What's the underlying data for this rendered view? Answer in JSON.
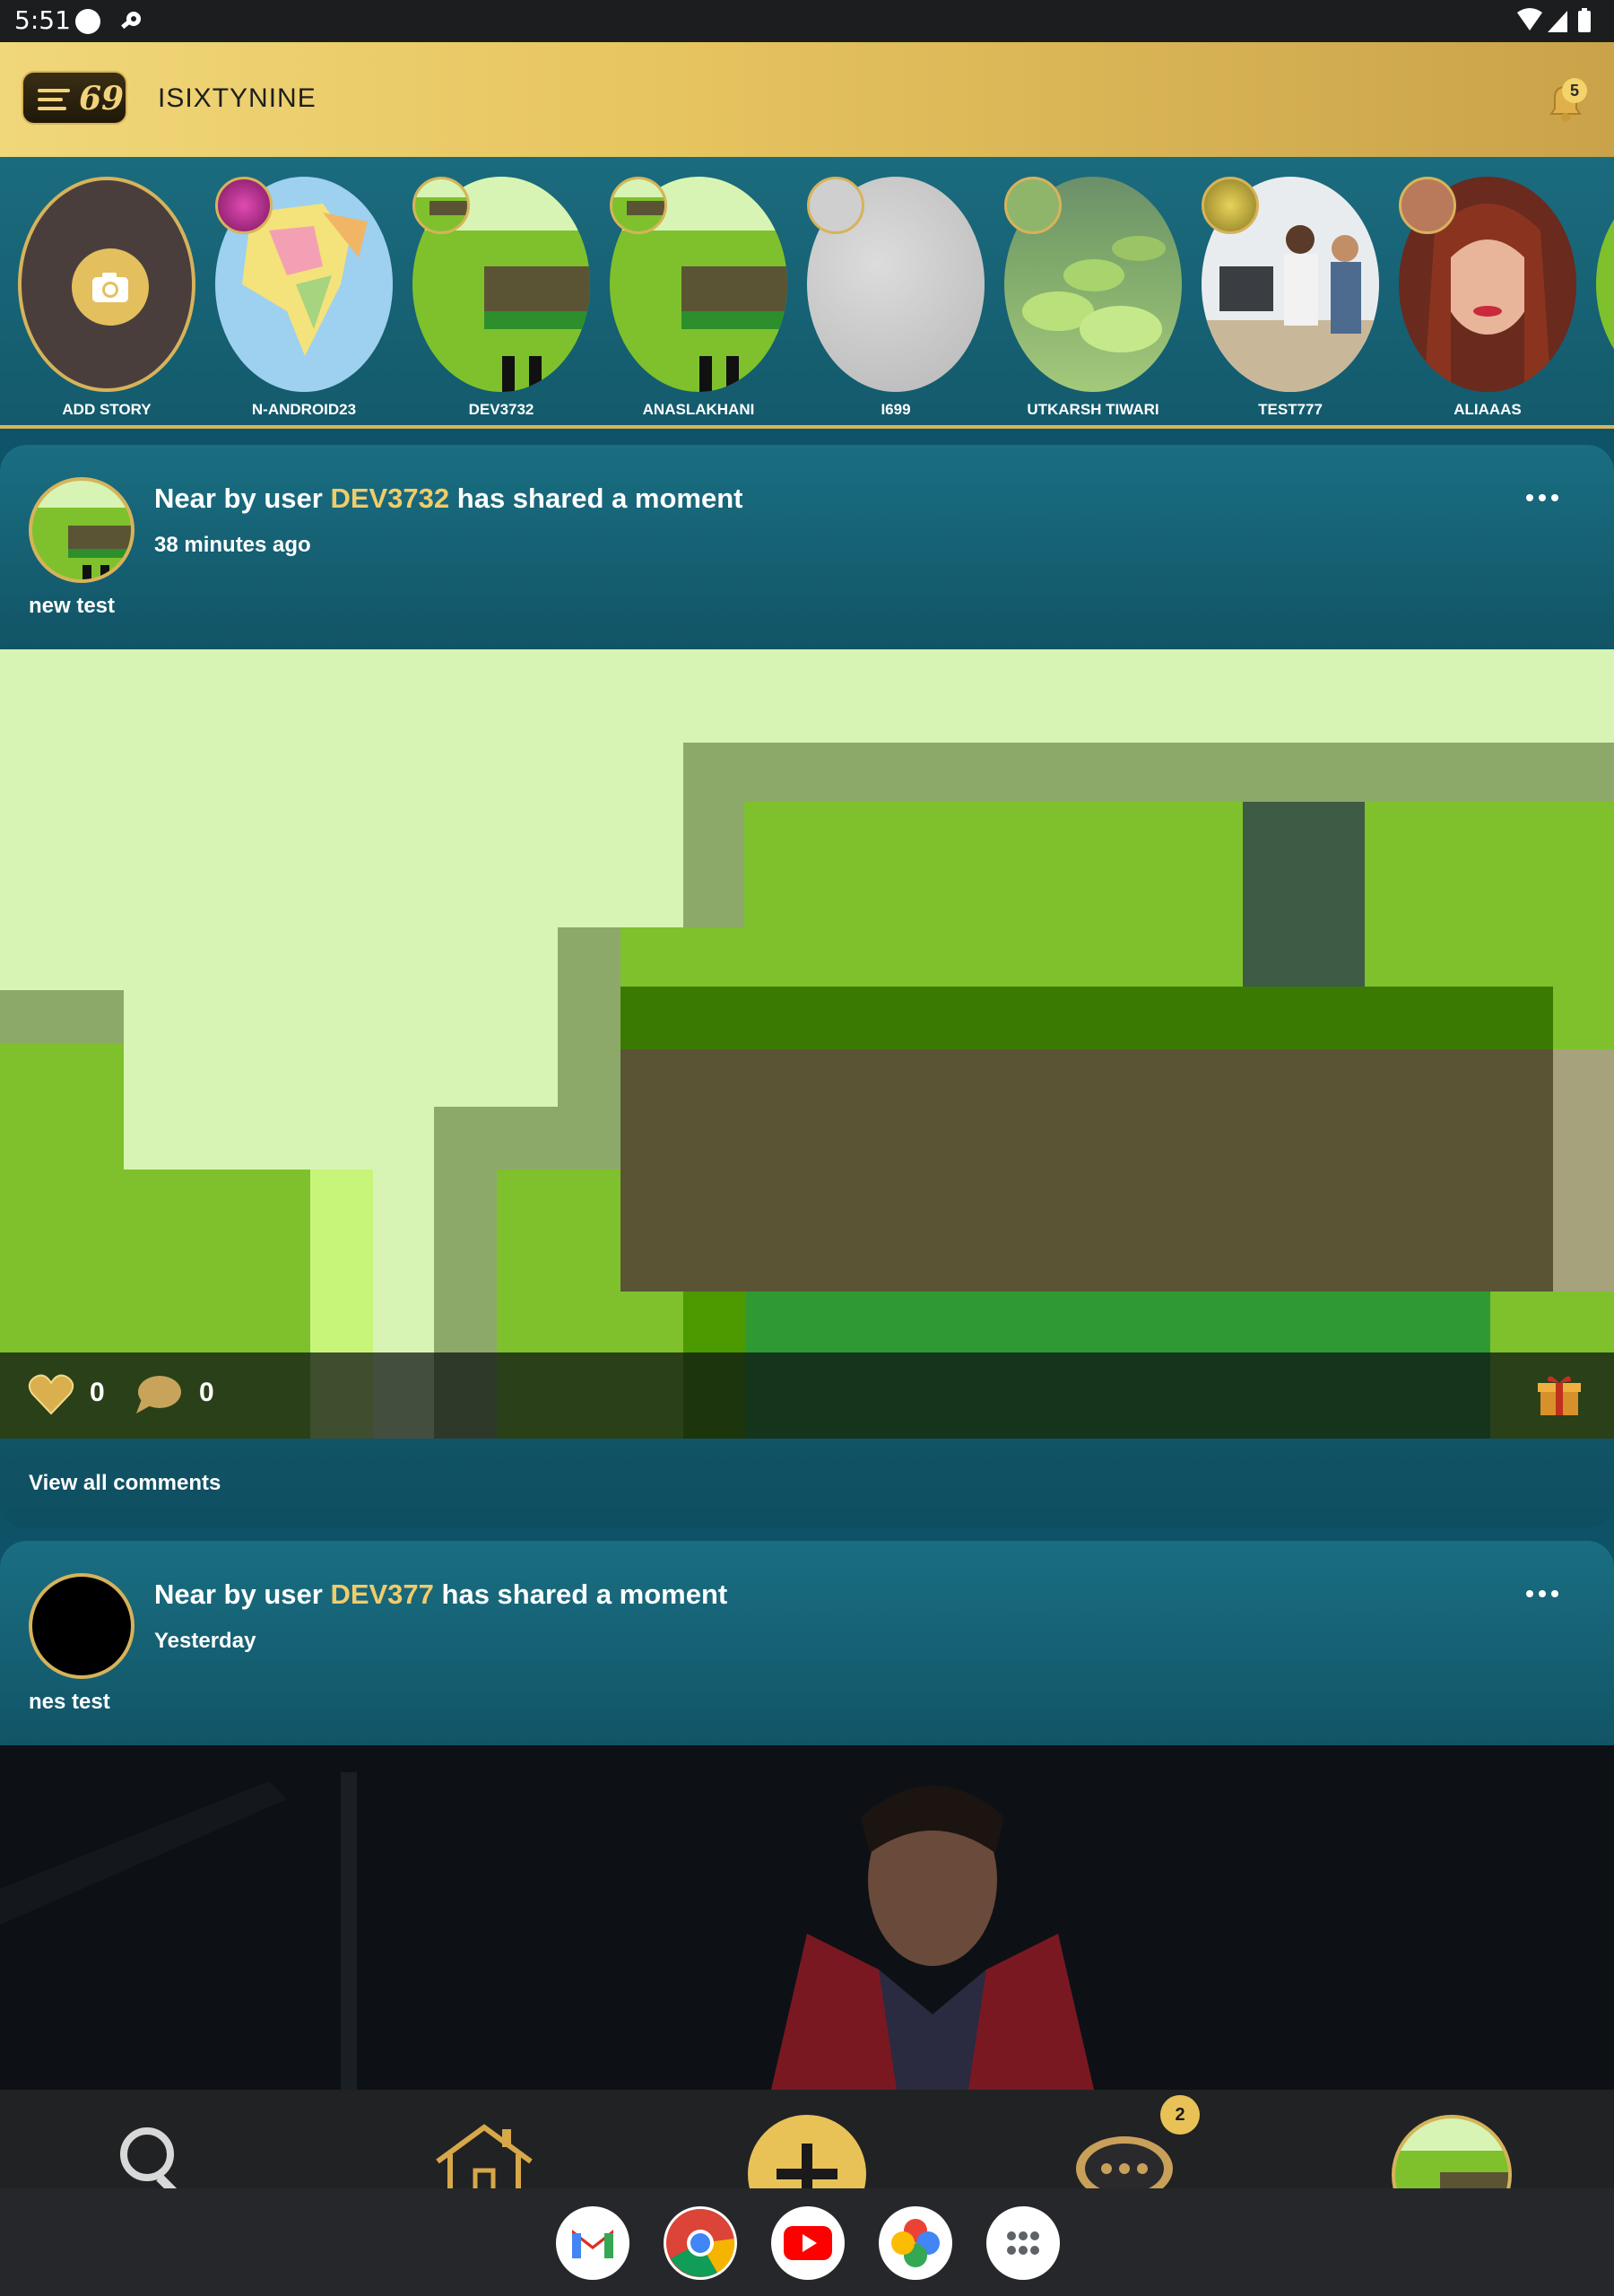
{
  "status_bar": {
    "time": "5:51"
  },
  "app_bar": {
    "title": "ISIXTYNINE",
    "logo_text": "69",
    "notification_count": "5"
  },
  "stories": [
    {
      "label": "ADD STORY"
    },
    {
      "label": "N-ANDROID23"
    },
    {
      "label": "DEV3732"
    },
    {
      "label": "ANASLAKHANI"
    },
    {
      "label": "I699"
    },
    {
      "label": "UTKARSH TIWARI"
    },
    {
      "label": "TEST777"
    },
    {
      "label": "ALIAAAS"
    }
  ],
  "posts": [
    {
      "prefix": "Near by user ",
      "user": "DEV3732",
      "suffix": " has shared a moment",
      "time": "38 minutes ago",
      "caption": "new  test",
      "likes": "0",
      "comments": "0",
      "view_comments": "View all comments"
    },
    {
      "prefix": "Near by user ",
      "user": "DEV377",
      "suffix": " has shared a moment",
      "time": "Yesterday",
      "caption": "nes test"
    }
  ],
  "bottom_nav": {
    "chat_badge": "2"
  },
  "dock": {
    "apps": [
      "gmail-icon",
      "chrome-icon",
      "youtube-icon",
      "photos-icon",
      "app-drawer-icon"
    ]
  },
  "colors": {
    "gold": "#d6b35a",
    "teal": "#0f5a70",
    "status_bar": "#1c1d1f"
  }
}
